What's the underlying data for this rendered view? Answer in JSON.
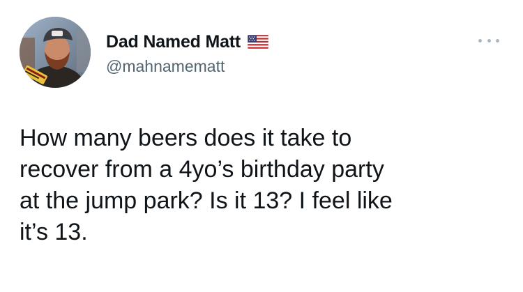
{
  "author": {
    "display_name": "Dad Named Matt",
    "handle": "@mahnamematt",
    "flag_icon": "us-flag-icon"
  },
  "actions": {
    "more_icon": "more-options-icon"
  },
  "tweet": {
    "text": "How many beers does it take to\nrecover from a 4yo’s birthday party\nat the jump park? Is it 13? I feel like\nit’s 13."
  },
  "colors": {
    "text_primary": "#0f1419",
    "text_secondary": "#536471",
    "more_dots": "#aab8c2"
  }
}
